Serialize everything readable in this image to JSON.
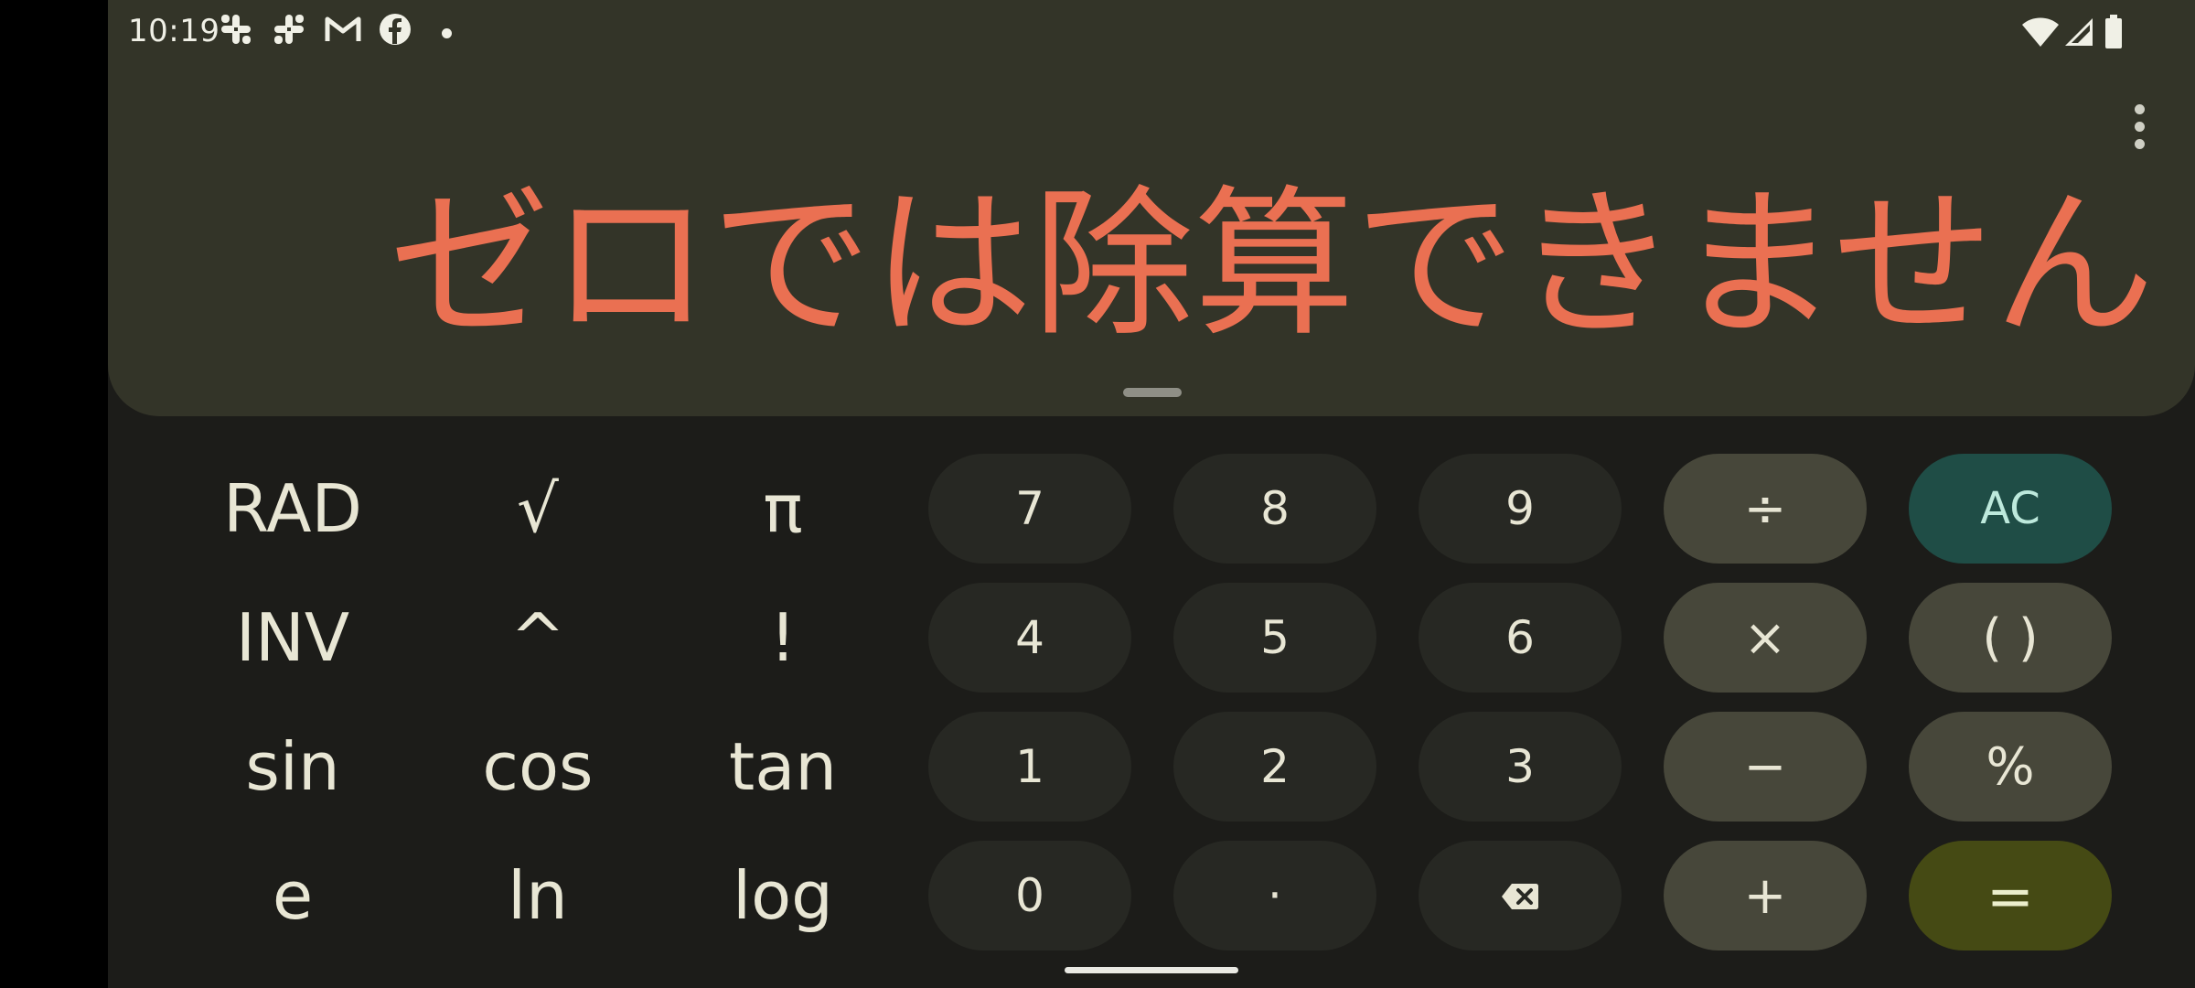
{
  "status_bar": {
    "time": "10:19",
    "notification_icons": [
      "slack-icon",
      "slack-icon",
      "gmail-icon",
      "facebook-icon",
      "more-dot-icon"
    ],
    "right_icons": [
      "wifi-icon",
      "cellular-signal-icon",
      "battery-icon"
    ]
  },
  "display": {
    "result_text": "ゼロでは除算できません",
    "result_color": "#ea7052",
    "menu_icon": "more-vert-icon"
  },
  "keypad": {
    "scientific": [
      "RAD",
      "√",
      "π",
      "INV",
      "^",
      "!",
      "sin",
      "cos",
      "tan",
      "e",
      "ln",
      "log"
    ],
    "digits": {
      "7": "7",
      "8": "8",
      "9": "9",
      "4": "4",
      "5": "5",
      "6": "6",
      "1": "1",
      "2": "2",
      "3": "3",
      "0": "0",
      "dot": "·"
    },
    "backspace_icon": "backspace-icon",
    "operators": {
      "divide": "÷",
      "multiply": "×",
      "minus": "−",
      "plus": "+",
      "clear": "AC",
      "parens": "( )",
      "percent": "%",
      "equals": "="
    }
  },
  "colors": {
    "background": "#1c1c19",
    "display_panel": "#333428",
    "number_key": "#272823",
    "operator_key": "#47473a",
    "clear_key": "#1f4d46",
    "equals_key": "#454a14"
  }
}
